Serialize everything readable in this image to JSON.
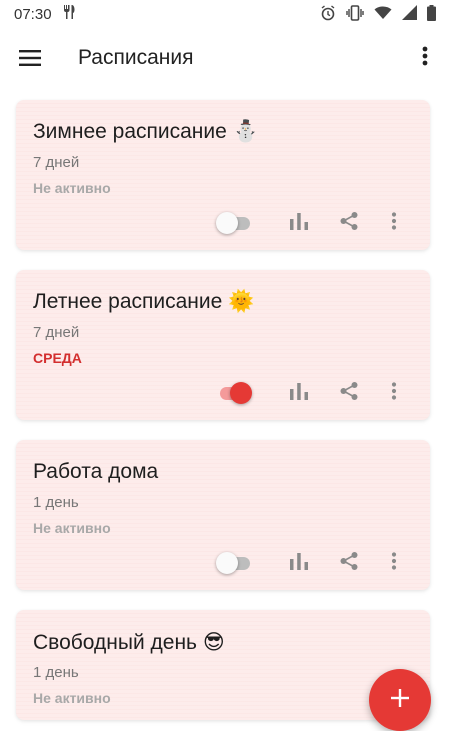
{
  "status_bar": {
    "time": "07:30",
    "icons": [
      "fork-knife-icon",
      "alarm-icon",
      "vibrate-icon",
      "wifi-icon",
      "signal-icon",
      "battery-icon"
    ]
  },
  "app_bar": {
    "title": "Расписания",
    "icons": [
      "hamburger-menu-icon",
      "more-vert-icon"
    ]
  },
  "colors": {
    "accent": "#e53935",
    "card_background": "#fdeceb",
    "inactive_text": "#a8a8a8"
  },
  "schedules": [
    {
      "title": "Зимнее расписание ⛄",
      "days": "7 дней",
      "status": "Не активно",
      "active": false
    },
    {
      "title": "Летнее расписание 🌞",
      "days": "7 дней",
      "status": "СРЕДА",
      "active": true
    },
    {
      "title": "Работа дома",
      "days": "1 день",
      "status": "Не активно",
      "active": false
    },
    {
      "title": "Свободный день 😎",
      "days": "1 день",
      "status": "Не активно",
      "active": false
    }
  ],
  "card_action_icons": [
    "bar-chart-icon",
    "share-icon",
    "more-vert-icon"
  ],
  "fab": {
    "label": "+",
    "icon": "plus-icon"
  }
}
